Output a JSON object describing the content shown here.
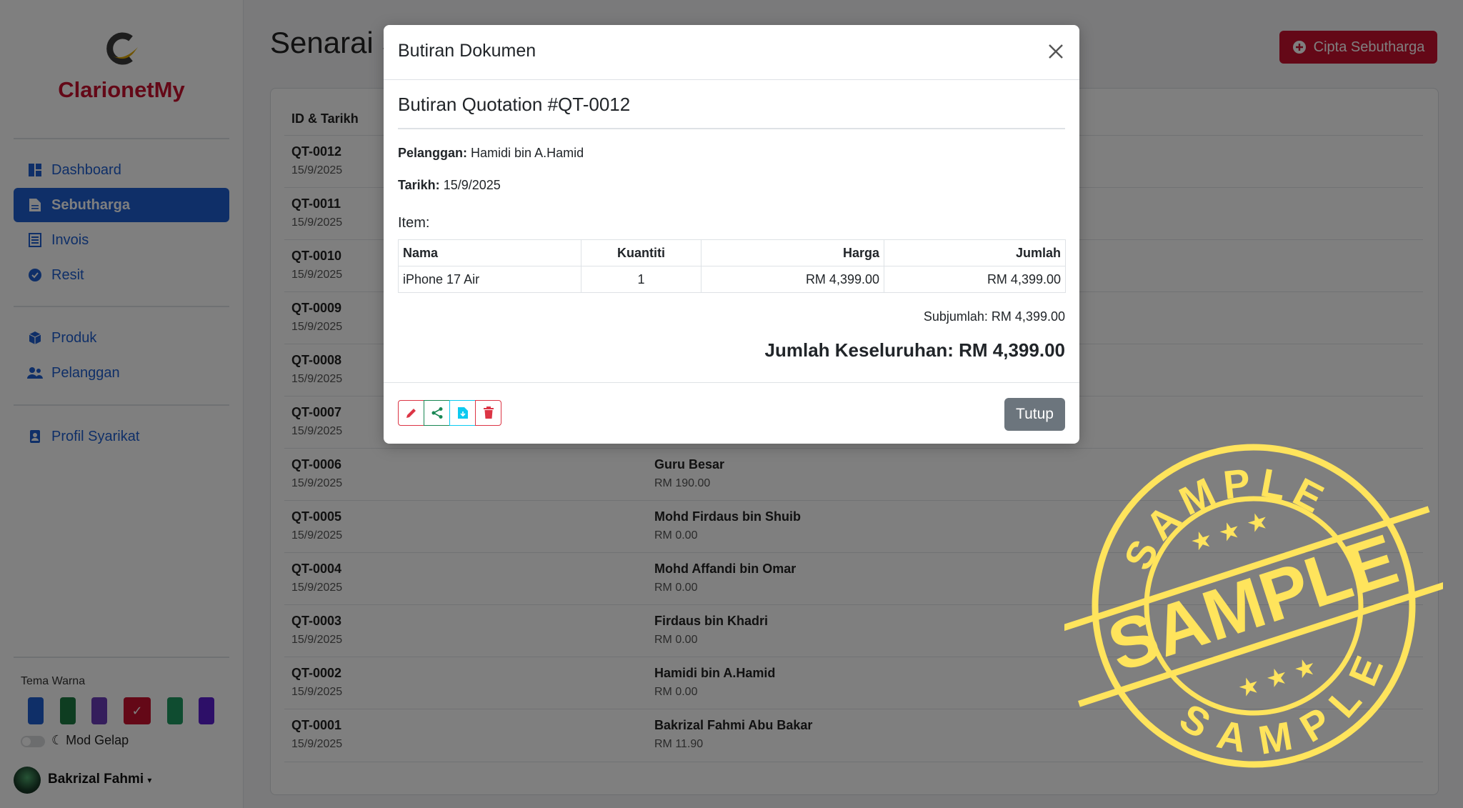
{
  "sidebar": {
    "brand": "ClarionetMy",
    "nav_main": [
      {
        "label": "Dashboard",
        "icon": "dashboard-icon"
      },
      {
        "label": "Sebutharga",
        "icon": "document-icon",
        "active": true
      },
      {
        "label": "Invois",
        "icon": "invoice-icon"
      },
      {
        "label": "Resit",
        "icon": "check-badge-icon"
      }
    ],
    "nav_data": [
      {
        "label": "Produk",
        "icon": "box-icon"
      },
      {
        "label": "Pelanggan",
        "icon": "people-icon"
      }
    ],
    "nav_settings": [
      {
        "label": "Profil Syarikat",
        "icon": "id-badge-icon"
      }
    ],
    "theme_label": "Tema Warna",
    "theme_colors": [
      "#1f5fd0",
      "#1c7a43",
      "#6a3db8",
      "#c8102e",
      "#1f9960",
      "#5a1fd0"
    ],
    "selected_theme": "#c8102e",
    "dark_mode_label": "Mod Gelap",
    "user_name": "Bakrizal Fahmi"
  },
  "main": {
    "title": "Senarai Sebutharga",
    "create_button": "Cipta Sebutharga",
    "column_header": "ID & Tarikh",
    "rows": [
      {
        "id": "QT-0012",
        "date": "15/9/2025",
        "customer": "",
        "amount": ""
      },
      {
        "id": "QT-0011",
        "date": "15/9/2025",
        "customer": "",
        "amount": ""
      },
      {
        "id": "QT-0010",
        "date": "15/9/2025",
        "customer": "",
        "amount": ""
      },
      {
        "id": "QT-0009",
        "date": "15/9/2025",
        "customer": "",
        "amount": ""
      },
      {
        "id": "QT-0008",
        "date": "15/9/2025",
        "customer": "",
        "amount": ""
      },
      {
        "id": "QT-0007",
        "date": "15/9/2025",
        "customer": "",
        "amount": ""
      },
      {
        "id": "QT-0006",
        "date": "15/9/2025",
        "customer": "Guru Besar",
        "amount": "RM 190.00"
      },
      {
        "id": "QT-0005",
        "date": "15/9/2025",
        "customer": "Mohd Firdaus bin Shuib",
        "amount": "RM 0.00"
      },
      {
        "id": "QT-0004",
        "date": "15/9/2025",
        "customer": "Mohd Affandi bin Omar",
        "amount": "RM 0.00"
      },
      {
        "id": "QT-0003",
        "date": "15/9/2025",
        "customer": "Firdaus bin Khadri",
        "amount": "RM 0.00"
      },
      {
        "id": "QT-0002",
        "date": "15/9/2025",
        "customer": "Hamidi bin A.Hamid",
        "amount": "RM 0.00"
      },
      {
        "id": "QT-0001",
        "date": "15/9/2025",
        "customer": "Bakrizal Fahmi Abu Bakar",
        "amount": "RM 11.90"
      }
    ]
  },
  "modal": {
    "title": "Butiran Dokumen",
    "doc_title": "Butiran Quotation #QT-0012",
    "customer_label": "Pelanggan:",
    "customer_value": "Hamidi bin A.Hamid",
    "date_label": "Tarikh:",
    "date_value": "15/9/2025",
    "items_label": "Item:",
    "table_headers": [
      "Nama",
      "Kuantiti",
      "Harga",
      "Jumlah"
    ],
    "items": [
      {
        "name": "iPhone 17 Air",
        "qty": "1",
        "price": "RM 4,399.00",
        "total": "RM 4,399.00"
      }
    ],
    "subtotal": "Subjumlah: RM 4,399.00",
    "grand_total": "Jumlah Keseluruhan: RM 4,399.00",
    "actions": [
      {
        "icon": "pencil-icon",
        "color": "#dc3545"
      },
      {
        "icon": "share-icon",
        "color": "#198754"
      },
      {
        "icon": "download-file-icon",
        "color": "#0dcaf0"
      },
      {
        "icon": "trash-icon",
        "color": "#dc3545"
      }
    ],
    "close_button": "Tutup"
  },
  "watermark": {
    "top": "SAMPLE",
    "center": "SAMPLE",
    "bottom": "SAMPLE",
    "color": "#ffe45c"
  }
}
